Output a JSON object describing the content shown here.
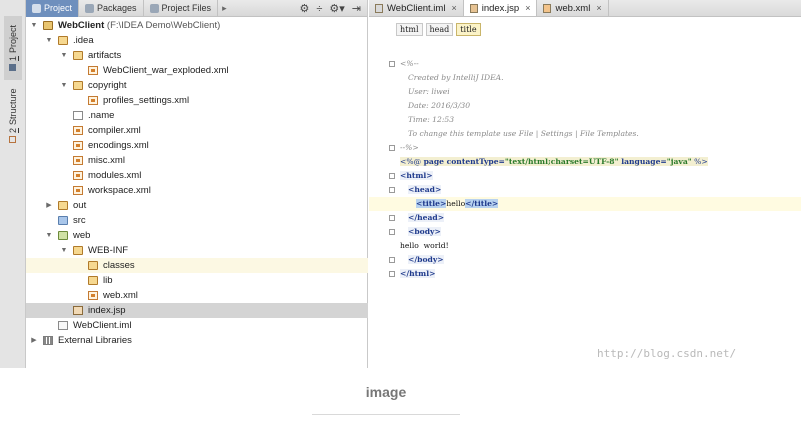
{
  "tool_strip": {
    "project": {
      "num": "1",
      "label": "Project"
    },
    "structure": {
      "num": "2",
      "label": "Structure"
    }
  },
  "project_panel": {
    "tabs": [
      {
        "label": "Project",
        "icon": "project-icon"
      },
      {
        "label": "Packages",
        "icon": "packages-icon"
      },
      {
        "label": "Project Files",
        "icon": "project-files-icon"
      }
    ],
    "more_arrow": "▸",
    "tools": {
      "sync": "⚙",
      "collapse": "÷",
      "settings": "⚙▾",
      "hide": "⇥"
    }
  },
  "tree": [
    {
      "depth": 0,
      "arrow": "▼",
      "icon": "folder-root",
      "label": "WebClient",
      "suffix": " (F:\\IDEA Demo\\WebClient)",
      "bold": true
    },
    {
      "depth": 1,
      "arrow": "▼",
      "icon": "folder",
      "label": ".idea"
    },
    {
      "depth": 2,
      "arrow": "▼",
      "icon": "folder",
      "label": "artifacts"
    },
    {
      "depth": 3,
      "arrow": "",
      "icon": "xml",
      "label": "WebClient_war_exploded.xml"
    },
    {
      "depth": 2,
      "arrow": "▼",
      "icon": "folder",
      "label": "copyright"
    },
    {
      "depth": 3,
      "arrow": "",
      "icon": "xml",
      "label": "profiles_settings.xml"
    },
    {
      "depth": 2,
      "arrow": "",
      "icon": "doc",
      "label": ".name"
    },
    {
      "depth": 2,
      "arrow": "",
      "icon": "xml",
      "label": "compiler.xml"
    },
    {
      "depth": 2,
      "arrow": "",
      "icon": "xml",
      "label": "encodings.xml"
    },
    {
      "depth": 2,
      "arrow": "",
      "icon": "xml",
      "label": "misc.xml"
    },
    {
      "depth": 2,
      "arrow": "",
      "icon": "xml",
      "label": "modules.xml"
    },
    {
      "depth": 2,
      "arrow": "",
      "icon": "xml",
      "label": "workspace.xml"
    },
    {
      "depth": 1,
      "arrow": "▶",
      "icon": "folder",
      "label": "out"
    },
    {
      "depth": 1,
      "arrow": "",
      "icon": "folder-blue",
      "label": "src"
    },
    {
      "depth": 1,
      "arrow": "▼",
      "icon": "folder-web",
      "label": "web"
    },
    {
      "depth": 2,
      "arrow": "▼",
      "icon": "folder",
      "label": "WEB-INF"
    },
    {
      "depth": 3,
      "arrow": "",
      "icon": "folder",
      "label": "classes",
      "highlight": true
    },
    {
      "depth": 3,
      "arrow": "",
      "icon": "folder",
      "label": "lib"
    },
    {
      "depth": 3,
      "arrow": "",
      "icon": "xml",
      "label": "web.xml"
    },
    {
      "depth": 2,
      "arrow": "",
      "icon": "jsp",
      "label": "index.jsp",
      "selected": true
    },
    {
      "depth": 1,
      "arrow": "",
      "icon": "iml",
      "label": "WebClient.iml"
    },
    {
      "depth": 0,
      "arrow": "▶",
      "icon": "lib",
      "label": "External Libraries"
    }
  ],
  "editor": {
    "tabs": [
      {
        "label": "WebClient.iml",
        "icon": "iml",
        "active": false,
        "close": "×"
      },
      {
        "label": "index.jsp",
        "icon": "jsp",
        "active": true,
        "close": "×"
      },
      {
        "label": "web.xml",
        "icon": "xml",
        "active": false,
        "close": "×"
      }
    ],
    "breadcrumbs": [
      "html",
      "head",
      "title"
    ],
    "code": [
      {
        "fold": true,
        "indent": 0,
        "parts": [
          {
            "t": "<%--",
            "c": "cm"
          }
        ]
      },
      {
        "indent": 1,
        "parts": [
          {
            "t": "Created by IntelliJ IDEA.",
            "c": "cm"
          }
        ]
      },
      {
        "indent": 1,
        "parts": [
          {
            "t": "User: liwei",
            "c": "cm"
          }
        ]
      },
      {
        "indent": 1,
        "parts": [
          {
            "t": "Date: 2016/3/30",
            "c": "cm"
          }
        ]
      },
      {
        "indent": 1,
        "parts": [
          {
            "t": "Time: 12:53",
            "c": "cm"
          }
        ]
      },
      {
        "indent": 1,
        "parts": [
          {
            "t": "To change this template use File | Settings | File Templates.",
            "c": "cm"
          }
        ]
      },
      {
        "fold": true,
        "indent": 0,
        "parts": [
          {
            "t": "--%>",
            "c": "cm"
          }
        ]
      },
      {
        "indent": 0,
        "parts": [
          {
            "t": "<%@ ",
            "c": "dir"
          },
          {
            "t": "page ",
            "c": "attr dir"
          },
          {
            "t": "contentType=",
            "c": "attr dir"
          },
          {
            "t": "\"text/html;charset=UTF-8\"",
            "c": "str dir"
          },
          {
            "t": " language=",
            "c": "attr dir"
          },
          {
            "t": "\"java\"",
            "c": "str dir"
          },
          {
            "t": " %>",
            "c": "dir"
          }
        ]
      },
      {
        "fold": true,
        "indent": 0,
        "parts": [
          {
            "t": "<html>",
            "c": "tag tagbox"
          }
        ]
      },
      {
        "fold": true,
        "indent": 1,
        "parts": [
          {
            "t": "<head>",
            "c": "tag tagbox"
          }
        ]
      },
      {
        "cur": true,
        "indent": 2,
        "parts": [
          {
            "t": "<title>",
            "c": "hlTag"
          },
          {
            "t": "hello",
            "c": "plain"
          },
          {
            "t": "</title>",
            "c": "hlTag"
          }
        ]
      },
      {
        "fold": true,
        "indent": 1,
        "parts": [
          {
            "t": "</head>",
            "c": "tag tagbox"
          }
        ]
      },
      {
        "fold": true,
        "indent": 1,
        "parts": [
          {
            "t": "<body>",
            "c": "tag tagbox"
          }
        ]
      },
      {
        "indent": 0,
        "parts": [
          {
            "t": "hello  world!",
            "c": "plain"
          }
        ]
      },
      {
        "fold": true,
        "indent": 1,
        "parts": [
          {
            "t": "</body>",
            "c": "tag tagbox"
          }
        ]
      },
      {
        "fold": true,
        "indent": 0,
        "parts": [
          {
            "t": "</html>",
            "c": "tag tagbox"
          }
        ]
      }
    ]
  },
  "watermark": "http://blog.csdn.net/",
  "caption": "image"
}
